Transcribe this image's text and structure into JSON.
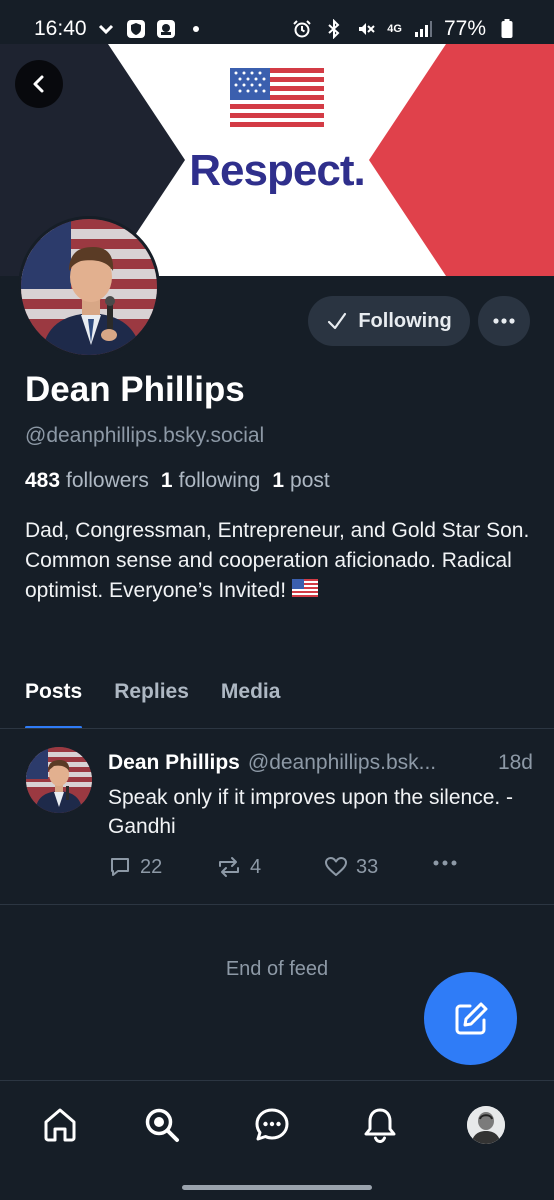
{
  "status_bar": {
    "time": "16:40",
    "battery": "77%",
    "network": "4G"
  },
  "banner": {
    "slogan": "Respect.",
    "colors": {
      "left": "#1e2330",
      "right": "#e0414b",
      "center": "#ffffff",
      "text": "#2f2f8c"
    }
  },
  "profile": {
    "display_name": "Dean Phillips",
    "handle": "@deanphillips.bsky.social",
    "followers_count": "483",
    "followers_label": "followers",
    "following_count": "1",
    "following_label": "following",
    "posts_count": "1",
    "posts_label": "post",
    "bio": "Dad, Congressman, Entrepreneur, and Gold Star Son. Common sense and cooperation aficionado. Radical optimist. Everyone’s Invited!",
    "following_button_label": "Following"
  },
  "tabs": [
    {
      "label": "Posts",
      "active": true
    },
    {
      "label": "Replies",
      "active": false
    },
    {
      "label": "Media",
      "active": false
    }
  ],
  "posts": [
    {
      "author": "Dean Phillips",
      "handle": "@deanphillips.bsk...",
      "time": "18d",
      "text": "Speak only if it improves upon the silence. -Gandhi",
      "replies": "22",
      "reposts": "4",
      "likes": "33"
    }
  ],
  "feed": {
    "end_label": "End of feed"
  },
  "bottom_nav": [
    {
      "icon": "home-icon"
    },
    {
      "icon": "search-icon"
    },
    {
      "icon": "chat-icon"
    },
    {
      "icon": "bell-icon"
    },
    {
      "icon": "profile-avatar"
    }
  ],
  "accent_color": "#2f7cf7"
}
